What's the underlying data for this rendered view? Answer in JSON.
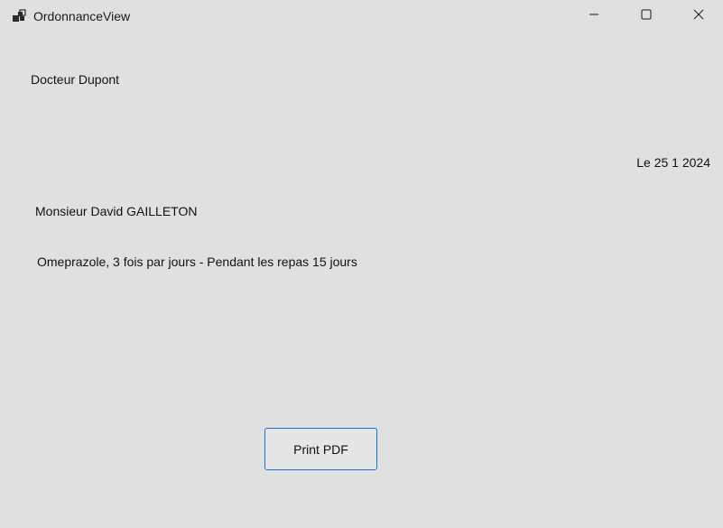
{
  "window": {
    "title": "OrdonnanceView",
    "icon": "app-window-icon",
    "controls": [
      "minimize-icon",
      "maximize-icon",
      "close-icon"
    ]
  },
  "ordonnance": {
    "doctor": "Docteur Dupont",
    "date": "Le 25 1 2024",
    "patient": "Monsieur David GAILLETON",
    "prescription": "Omeprazole, 3 fois par jours - Pendant les repas 15 jours"
  },
  "actions": {
    "print_label": "Print PDF"
  },
  "colors": {
    "background": "#e0e0e0",
    "button_border": "#1a73c9"
  }
}
